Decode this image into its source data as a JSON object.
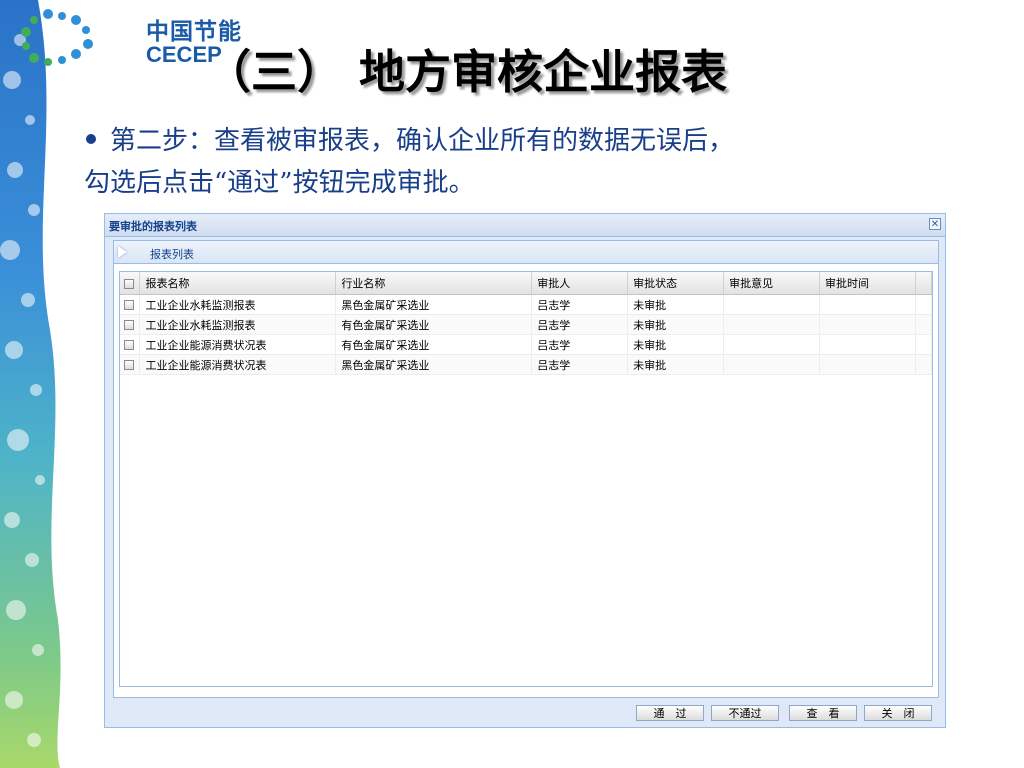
{
  "logo": {
    "cn_text": "中国节能",
    "en_text": "CECEP"
  },
  "slide": {
    "title": "（三） 地方审核企业报表",
    "bullet_line1": "第二步：查看被审报表，确认企业所有的数据无误后，",
    "bullet_line2": "勾选后点击“通过”按钮完成审批。"
  },
  "dialog": {
    "title": "要审批的报表列表",
    "close_icon": "close-icon",
    "panel_title": "报表列表",
    "columns": [
      "报表名称",
      "行业名称",
      "审批人",
      "审批状态",
      "审批意见",
      "审批时间"
    ],
    "rows": [
      {
        "report": "工业企业水耗监测报表",
        "industry": "黑色金属矿采选业",
        "approver": "吕志学",
        "status": "未审批",
        "opinion": "",
        "time": ""
      },
      {
        "report": "工业企业水耗监测报表",
        "industry": "有色金属矿采选业",
        "approver": "吕志学",
        "status": "未审批",
        "opinion": "",
        "time": ""
      },
      {
        "report": "工业企业能源消费状况表",
        "industry": "有色金属矿采选业",
        "approver": "吕志学",
        "status": "未审批",
        "opinion": "",
        "time": ""
      },
      {
        "report": "工业企业能源消费状况表",
        "industry": "黑色金属矿采选业",
        "approver": "吕志学",
        "status": "未审批",
        "opinion": "",
        "time": ""
      }
    ],
    "buttons": {
      "pass": "通　过",
      "reject": "不通过",
      "view": "查　看",
      "close": "关　闭"
    }
  },
  "colors": {
    "title_text": "#000000",
    "bullet_text": "#1a3f8a",
    "logo_blue": "#1a5aa6",
    "window_bg": "#dfe8f6",
    "window_border": "#99bbe8"
  }
}
